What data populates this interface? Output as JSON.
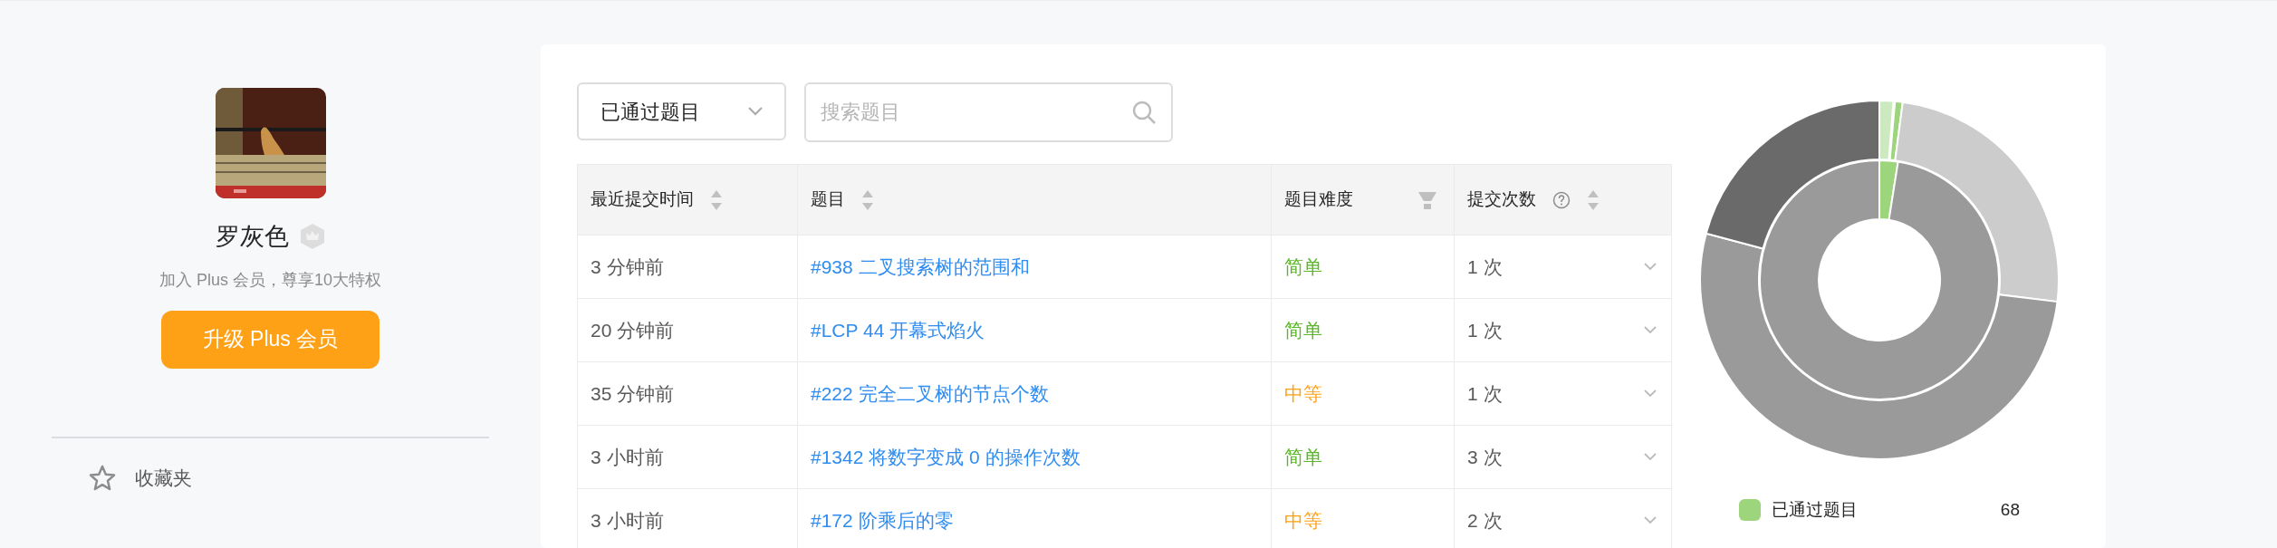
{
  "profile": {
    "name": "罗灰色",
    "promo": "加入 Plus 会员，尊享10大特权",
    "upgrade_button": "升级 Plus 会员",
    "menu": [
      {
        "label": "收藏夹"
      }
    ]
  },
  "filter": {
    "value": "已通过题目"
  },
  "search": {
    "placeholder": "搜索题目"
  },
  "table": {
    "columns": [
      "最近提交时间",
      "题目",
      "题目难度",
      "提交次数"
    ],
    "rows": [
      {
        "time": "3 分钟前",
        "problem": "#938 二叉搜索树的范围和",
        "difficulty": {
          "text": "简单",
          "kind": "easy"
        },
        "submissions": "1 次"
      },
      {
        "time": "20 分钟前",
        "problem": "#LCP 44 开幕式焰火",
        "difficulty": {
          "text": "简单",
          "kind": "easy"
        },
        "submissions": "1 次"
      },
      {
        "time": "35 分钟前",
        "problem": "#222 完全二叉树的节点个数",
        "difficulty": {
          "text": "中等",
          "kind": "medium"
        },
        "submissions": "1 次"
      },
      {
        "time": "3 小时前",
        "problem": "#1342 将数字变成 0 的操作次数",
        "difficulty": {
          "text": "简单",
          "kind": "easy"
        },
        "submissions": "3 次"
      },
      {
        "time": "3 小时前",
        "problem": "#172 阶乘后的零",
        "difficulty": {
          "text": "中等",
          "kind": "medium"
        },
        "submissions": "2 次"
      }
    ]
  },
  "legend": [
    {
      "label": "已通过题目",
      "count": "68",
      "color": "#9dd57d"
    }
  ]
}
